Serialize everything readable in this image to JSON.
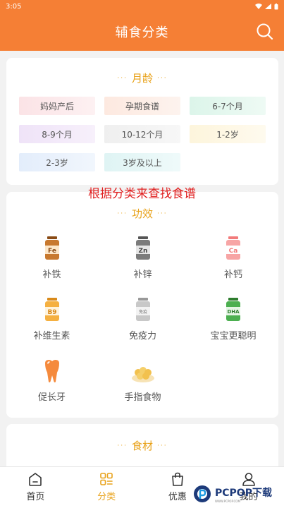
{
  "status": {
    "time": "3:05"
  },
  "header": {
    "title": "辅食分类"
  },
  "month_section": {
    "title": "月龄",
    "items": [
      "妈妈产后",
      "孕期食谱",
      "6-7个月",
      "8-9个月",
      "10-12个月",
      "1-2岁",
      "2-3岁",
      "3岁及以上"
    ]
  },
  "overlay": {
    "text": "根据分类来查找食谱"
  },
  "effect_section": {
    "title": "功效",
    "items": [
      {
        "label": "补铁",
        "icon": "iron-bottle-icon",
        "mark": "Fe",
        "color": "#b5651d"
      },
      {
        "label": "补锌",
        "icon": "zinc-bottle-icon",
        "mark": "Zn",
        "color": "#6b6b6b"
      },
      {
        "label": "补钙",
        "icon": "calcium-bottle-icon",
        "mark": "Ca",
        "color": "#f08a8a"
      },
      {
        "label": "补维生素",
        "icon": "vitamin-bottle-icon",
        "mark": "B9",
        "color": "#f0a030"
      },
      {
        "label": "免疫力",
        "icon": "immunity-bottle-icon",
        "mark": "免疫",
        "color": "#a0a0a0"
      },
      {
        "label": "宝宝更聪明",
        "icon": "dha-bottle-icon",
        "mark": "DHA",
        "color": "#3a9a3a"
      },
      {
        "label": "促长牙",
        "icon": "tooth-icon",
        "mark": "",
        "color": "#f58a3c"
      },
      {
        "label": "手指食物",
        "icon": "finger-food-bowl-icon",
        "mark": "",
        "color": "#f2c14e"
      }
    ]
  },
  "food_section": {
    "title": "食材"
  },
  "bottom_nav": {
    "items": [
      {
        "label": "首页",
        "icon": "home-icon"
      },
      {
        "label": "分类",
        "icon": "category-icon"
      },
      {
        "label": "优惠",
        "icon": "shopping-bag-icon"
      },
      {
        "label": "我的",
        "icon": "person-icon"
      }
    ],
    "active_index": 1
  },
  "watermark": {
    "text": "PCPOP下载",
    "sub": "WWW.PCPOP.COM"
  },
  "colors": {
    "accent": "#f57f35",
    "gold": "#e8a21a",
    "overlay_red": "#e02020"
  }
}
